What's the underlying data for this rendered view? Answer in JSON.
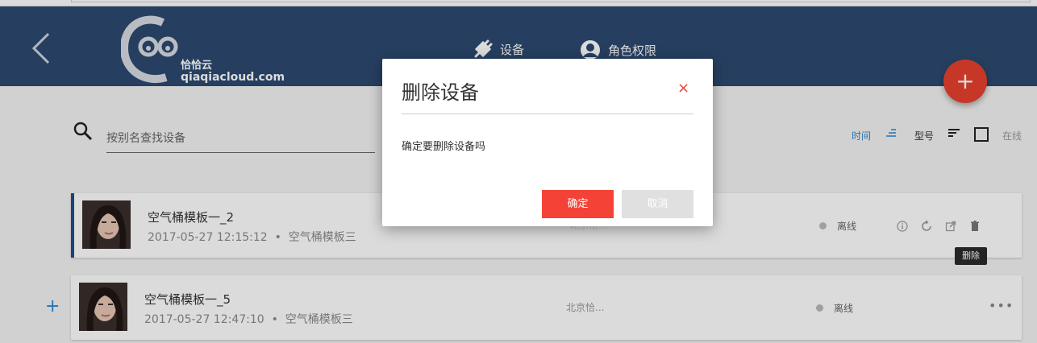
{
  "header": {
    "logo_cn": "恰恰云",
    "logo_en": "qiaqiacloud.com",
    "nav": [
      {
        "label": "设备",
        "icon": "plug-icon"
      },
      {
        "label": "角色权限",
        "icon": "user-circle-icon"
      }
    ],
    "fab_label": "+"
  },
  "search": {
    "placeholder": "按别名查找设备"
  },
  "sort": {
    "time_label": "时间",
    "model_label": "型号",
    "online_label": "在线",
    "accent_color": "#2b87d3"
  },
  "devices": [
    {
      "name": "空气桶模板一_2",
      "date": "2017-05-27 12:15:12",
      "separator": "•",
      "template": "空气桶模板三",
      "location": "北京恰...",
      "status": "离线"
    },
    {
      "name": "空气桶模板一_5",
      "date": "2017-05-27 12:47:10",
      "separator": "•",
      "template": "空气桶模板三",
      "location": "北京恰...",
      "status": "离线"
    }
  ],
  "row_actions": [
    "info-icon",
    "refresh-icon",
    "open-external-icon",
    "trash-icon"
  ],
  "tooltip": "删除",
  "more": "•••",
  "add_plus": "+",
  "dialog": {
    "title": "删除设备",
    "close": "×",
    "message": "确定要删除设备吗",
    "ok": "确定",
    "cancel": "取消"
  },
  "colors": {
    "header_bg": "#2d4a70",
    "danger": "#f44336",
    "primary": "#1e4f8d"
  }
}
